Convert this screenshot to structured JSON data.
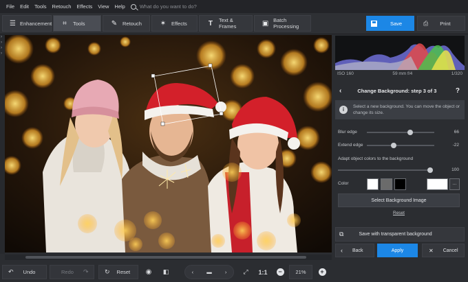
{
  "menu": [
    "File",
    "Edit",
    "Tools",
    "Retouch",
    "Effects",
    "View",
    "Help"
  ],
  "search": {
    "placeholder": "What do you want to do?"
  },
  "tabs": [
    {
      "label": "Enhancement",
      "icon": "sliders-icon",
      "active": false
    },
    {
      "label": "Tools",
      "icon": "crop-icon",
      "active": true
    },
    {
      "label": "Retouch",
      "icon": "brush-icon",
      "active": false
    },
    {
      "label": "Effects",
      "icon": "magic-wand-icon",
      "active": false
    },
    {
      "label": "Text & Frames",
      "icon": "text-icon",
      "active": false
    },
    {
      "label": "Batch Processing",
      "icon": "batch-icon",
      "active": false
    }
  ],
  "actions": {
    "save": "Save",
    "print": "Print"
  },
  "histogram": {
    "iso": "ISO 160",
    "lens": "59 mm f/4",
    "shutter": "1/320"
  },
  "panel": {
    "title": "Change Background: step 3 of 3",
    "help": "?",
    "info": "Select a new background. You can move the object or change its size.",
    "blur_edge": {
      "label": "Blur edge",
      "value": "66",
      "level": 0.66
    },
    "extend_edge": {
      "label": "Extend edge",
      "value": "-22",
      "level": 0.39
    },
    "adapt": {
      "label": "Adapt object colors to the background",
      "value": "100",
      "level": 1.0
    },
    "color_label": "Color",
    "swatches": [
      "#ffffff",
      "#6b6b6b",
      "#000000"
    ],
    "picker_color": "#ffffff",
    "more": "...",
    "select_bg": "Select Background Image",
    "reset": "Reset",
    "save_transparent": "Save with transparent background",
    "back": "Back",
    "apply": "Apply",
    "cancel": "Cancel"
  },
  "bottom": {
    "undo": "Undo",
    "redo": "Redo",
    "reset": "Reset",
    "ratio": "1:1",
    "zoom": "21%"
  },
  "colors": {
    "accent": "#1c87e6",
    "bg": "#2b2d31"
  }
}
